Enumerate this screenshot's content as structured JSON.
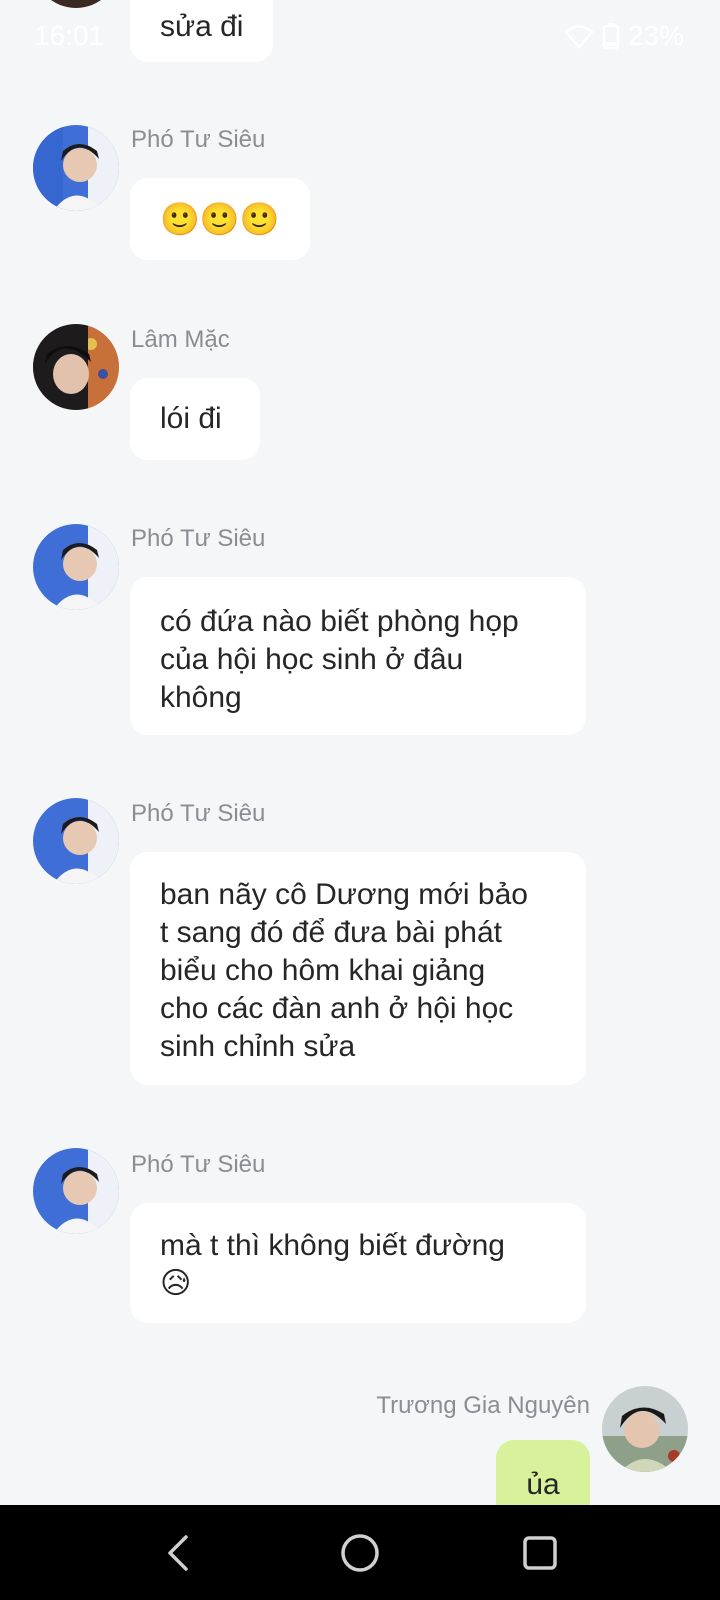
{
  "status_bar": {
    "time": "16:01",
    "battery": "23%"
  },
  "messages": [
    {
      "sender": "",
      "text": "sửa đi",
      "side": "left"
    },
    {
      "sender": "Phó Tư Siêu",
      "text": "🙂🙂🙂",
      "side": "left"
    },
    {
      "sender": "Lâm Mặc",
      "text": "lói đi",
      "side": "left"
    },
    {
      "sender": "Phó Tư Siêu",
      "lines": [
        "có đứa nào biết phòng họp",
        "của hội học sinh ở đâu",
        "không"
      ],
      "side": "left"
    },
    {
      "sender": "Phó Tư Siêu",
      "lines": [
        "ban nãy cô Dương mới bảo",
        "t sang đó để đưa bài phát",
        "biểu cho hôm khai giảng",
        "cho các đàn anh ở hội học",
        "sinh chỉnh sửa"
      ],
      "side": "left"
    },
    {
      "sender": "Phó Tư Siêu",
      "lines": [
        "mà t thì không biết đường",
        "😥"
      ],
      "side": "left"
    },
    {
      "sender": "Trương Gia Nguyên",
      "text": "ủa",
      "side": "right"
    }
  ],
  "icons": {
    "wifi": "wifi-icon",
    "battery": "battery-icon",
    "back": "back-icon",
    "home": "home-icon",
    "recents": "recents-icon"
  },
  "colors": {
    "background": "#f5f6f8",
    "bubble": "#ffffff",
    "my_bubble": "#d7f29a",
    "sender_name": "#8a8d94",
    "nav_bar": "#000000"
  }
}
